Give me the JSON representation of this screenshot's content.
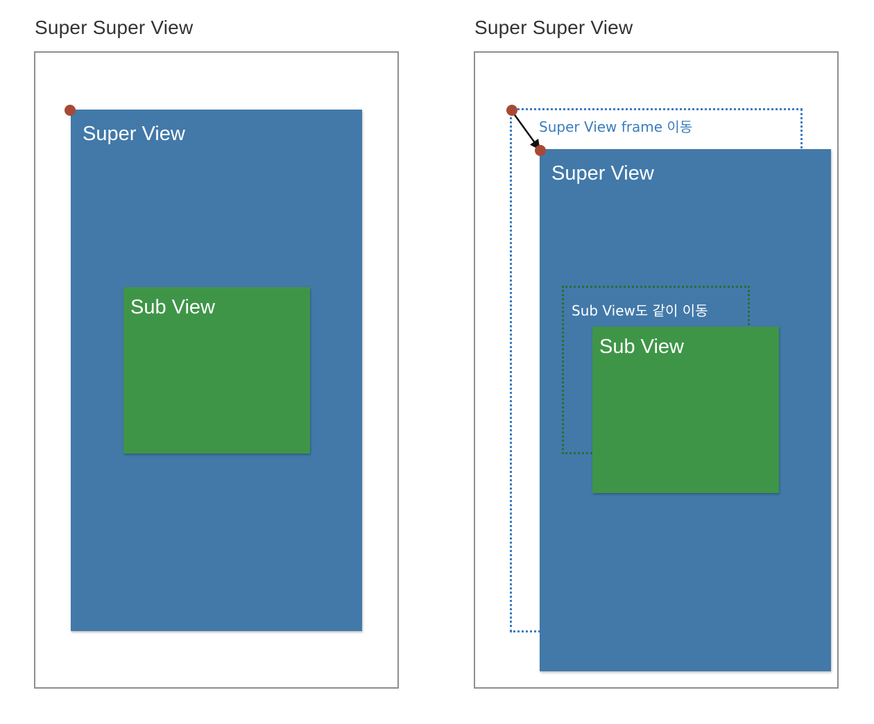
{
  "left_panel": {
    "title": "Super Super View",
    "super_view": {
      "label": "Super View"
    },
    "sub_view": {
      "label": "Sub View"
    }
  },
  "right_panel": {
    "title": "Super Super View",
    "super_view": {
      "label": "Super View"
    },
    "sub_view": {
      "label": "Sub View"
    },
    "frame_move_label": "Super View frame 이동",
    "sub_move_label": "Sub View도 같이 이동"
  },
  "colors": {
    "super_view_fill": "#4279a9",
    "sub_view_fill": "#3f9547",
    "origin_dot": "#a64a35",
    "frame_border": "#8e8e8e",
    "blue_dotted": "#3a7dbf",
    "green_dotted": "#2e6b35",
    "annotation_blue": "#3a7dbf",
    "annotation_white": "#ffffff",
    "arrow": "#111111"
  },
  "icons": {
    "origin_marker": "circle",
    "move_arrow": "arrow-down-right"
  }
}
